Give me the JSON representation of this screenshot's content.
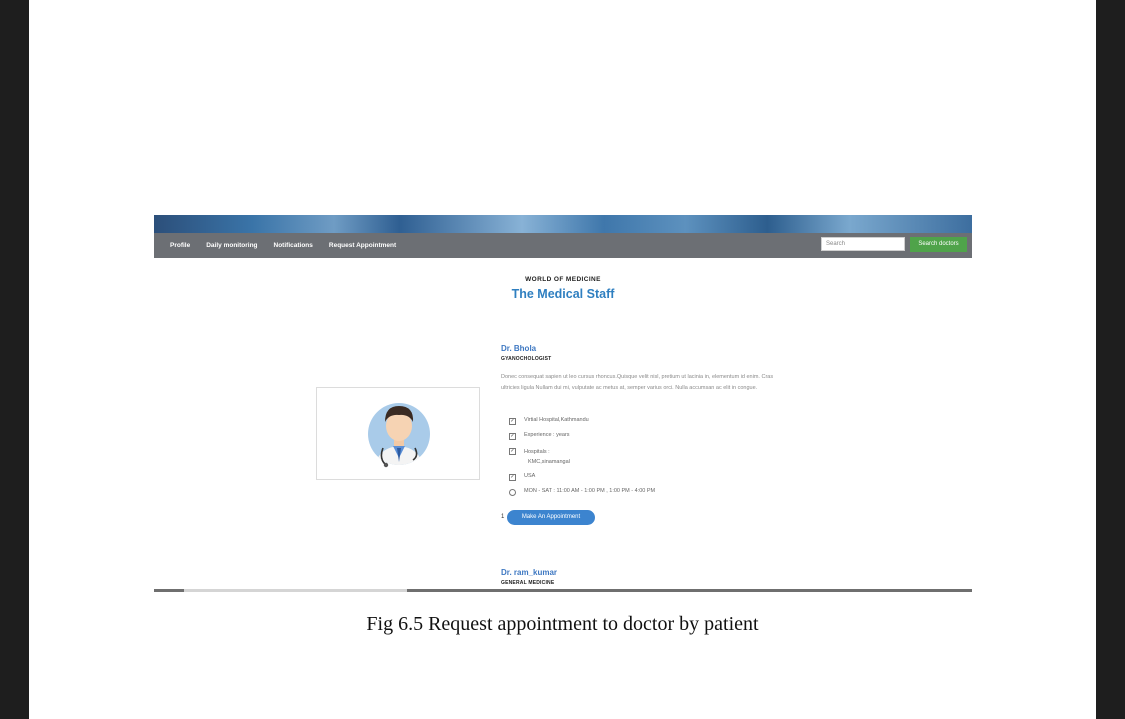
{
  "nav": {
    "items": [
      "Profile",
      "Daily monitoring",
      "Notifications",
      "Request Appointment"
    ],
    "search_placeholder": "Search",
    "search_button": "Search doctors"
  },
  "header": {
    "eyebrow": "WORLD OF MEDICINE",
    "title": "The Medical Staff"
  },
  "doctor1": {
    "name": "Dr. Bhola",
    "specialty": "GYANOCHOLOGIST",
    "description": "Donec consequat sapien ut leo cursus rhoncus.Quisque velit nisl, pretium ut lacinia in, elementum id enim. Cras ultricies ligula Nullam dui mi, vulputate ac metus at, semper varius orci. Nulla accumsan ac elit in congue.",
    "hospital": "Virtial Hospital,Kathmandu",
    "experience": "Experience : years",
    "hospitals_label": "Hospitals :",
    "hospitals_value": "KMC,sinamangal",
    "country": "USA",
    "hours": "MON - SAT : 11:00 AM - 1:00 PM , 1:00 PM - 4:00 PM",
    "counter": "1",
    "appointment_button": "Make An Appointment"
  },
  "doctor2": {
    "name": "Dr. ram_kumar",
    "specialty": "GENERAL MEDICINE"
  },
  "caption": "Fig 6.5 Request appointment to doctor by patient",
  "colors": {
    "nav_bg": "#6c6f74",
    "accent_blue": "#2f7fc0",
    "search_green": "#4fa34a",
    "button_blue": "#3c84cf"
  }
}
